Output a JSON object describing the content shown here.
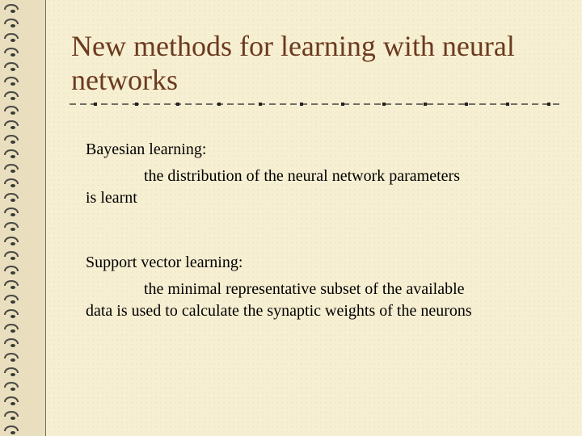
{
  "slide": {
    "title": "New methods for learning with neural networks",
    "sections": [
      {
        "heading": "Bayesian learning:",
        "text": "the distribution of the neural network parameters is learnt"
      },
      {
        "heading": "Support vector learning:",
        "text": "the minimal representative subset of the available data is used to calculate the synaptic weights of the neurons"
      }
    ]
  },
  "colors": {
    "background": "#f7efd2",
    "title": "#6b3a1f",
    "text": "#000000",
    "spiral_bar": "#e9dfbf"
  },
  "decoration": {
    "left_bar": "spiral-binding",
    "divider": "dash-dot-line"
  }
}
